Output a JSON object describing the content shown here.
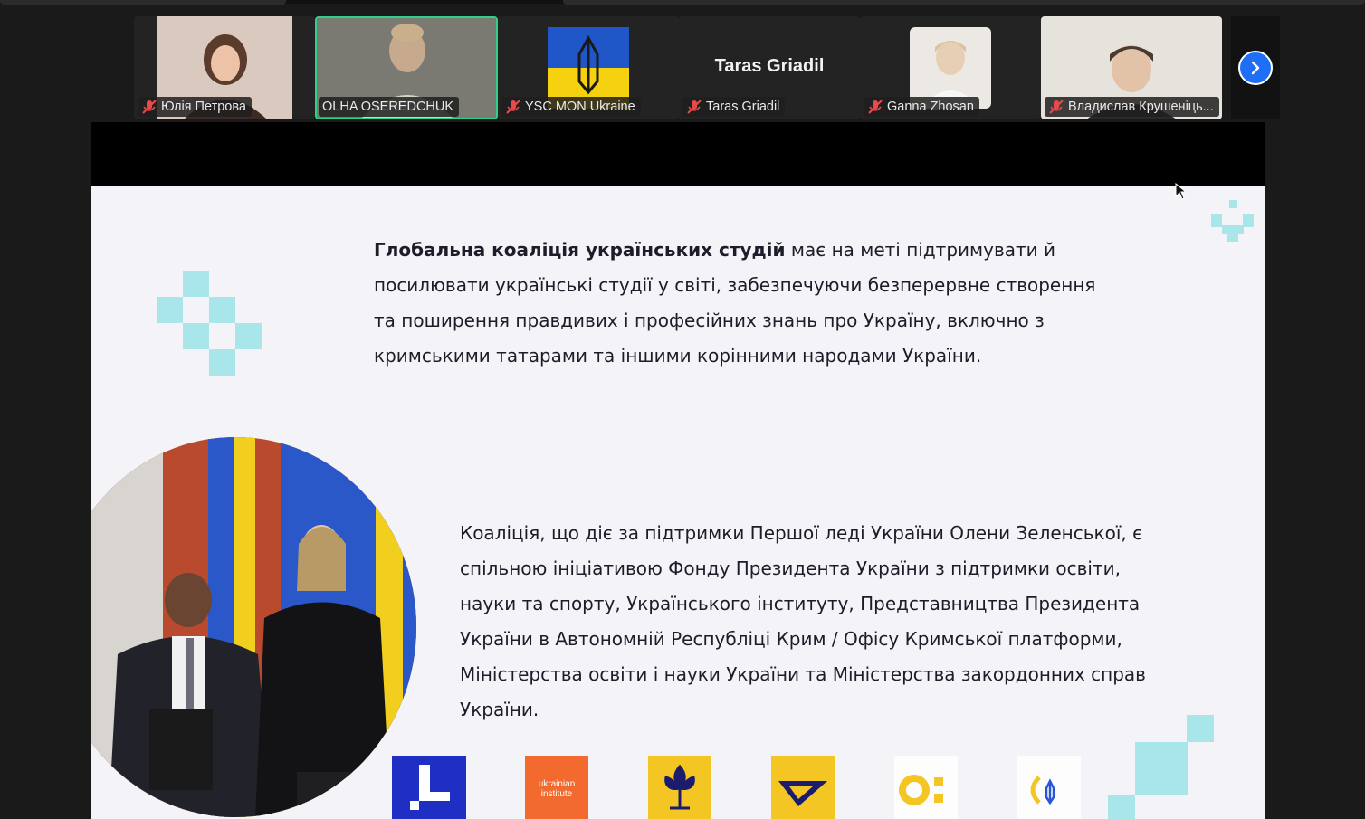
{
  "participants": [
    {
      "name": "Юлія Петрова",
      "muted": true,
      "type": "video"
    },
    {
      "name": "OLHA OSEREDCHUK",
      "muted": false,
      "type": "video",
      "active": true
    },
    {
      "name": "YSC MON Ukraine",
      "muted": true,
      "type": "avatar"
    },
    {
      "name": "Taras Griadil",
      "muted": true,
      "type": "name-only",
      "display_name": "Taras Griadil"
    },
    {
      "name": "Ganna Zhosan",
      "muted": true,
      "type": "avatar"
    },
    {
      "name": "Владислав Крушеніць...",
      "muted": true,
      "type": "video"
    }
  ],
  "controls": {
    "next_icon": "chevron-right-icon"
  },
  "slide": {
    "para1_bold": "Глобальна коаліція українських студій",
    "para1_lines": [
      " має на меті підтримувати й",
      "посилювати українські студії у світі, забезпечуючи безперервне створення",
      "та поширення правдивих і професійних знань про Україну, включно з",
      "кримськими татарами та іншими корінними народами України."
    ],
    "para2_lines": [
      "Коаліція, що діє за підтримки Першої леді України Олени Зеленської, є",
      "спільною ініціативою Фонду Президента України з підтримки освіти,",
      "науки та спорту, Українського інституту, Представництва Президента",
      "України в Автономній Республіці Крим / Офісу Кримської платформи,",
      "Міністерства освіти і науки України та Міністерства закордонних справ",
      "України."
    ],
    "logos": [
      {
        "name": "president-fund-logo",
        "color": "#1f2fc4"
      },
      {
        "name": "ukrainian-institute-logo",
        "color": "#f26a2e",
        "text": "ukrainian institute"
      },
      {
        "name": "flower-emblem-logo",
        "color": "#f4c623"
      },
      {
        "name": "mon-ukraine-logo",
        "color": "#f4c623"
      },
      {
        "name": "crimea-platform-logo",
        "color": "#f4c623"
      },
      {
        "name": "mfa-ukraine-logo",
        "color": "#2756d9"
      }
    ]
  },
  "colors": {
    "accent_green": "#2fd18a",
    "accent_blue": "#1e6ff5",
    "deco_cyan": "#a8e6ea"
  }
}
